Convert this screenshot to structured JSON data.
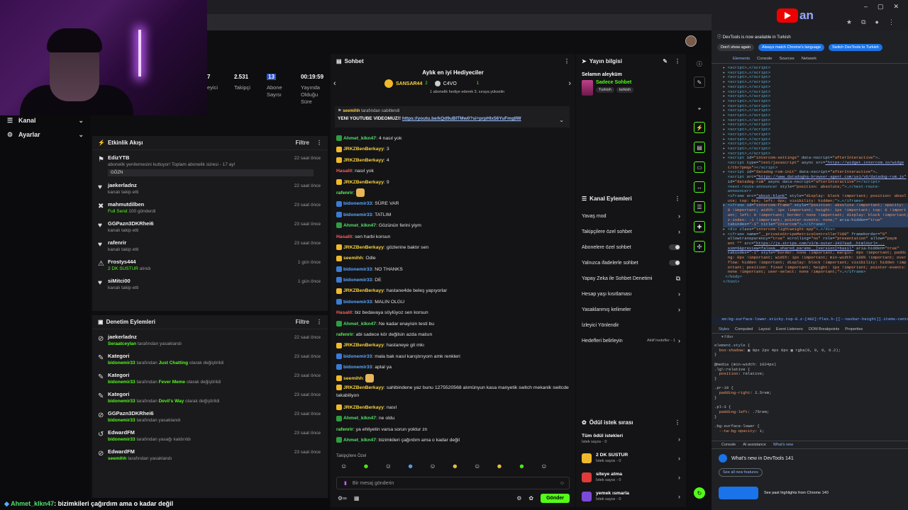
{
  "webcam": {
    "present": true
  },
  "brand": {
    "logo_text": "an"
  },
  "leftnav": {
    "items": [
      {
        "label": "Kanal"
      },
      {
        "label": "Ayarlar"
      }
    ]
  },
  "stats": [
    {
      "value": "7",
      "label": "eyici"
    },
    {
      "value": "2.531",
      "label": "Takipçi"
    },
    {
      "value": "13",
      "label": "Abone Sayısı"
    },
    {
      "value": "00:19:59",
      "label": "Yayında Olduğu Süre"
    }
  ],
  "activity": {
    "title": "Etkinlik Akışı",
    "filter": "Filtre",
    "items": [
      {
        "name": "EdizYTB",
        "sub": "abonelik yenilemesini kutluyor! Toplam abonelik süresi - 17 ay!",
        "tag": "GÖZN",
        "time": "22 saat önce"
      },
      {
        "name": "jaekerladnz",
        "sub": "kanalı takip etti",
        "time": "22 saat önce"
      },
      {
        "name": "mahmutdilben",
        "sub": "Full Send",
        "sub2": "100",
        "sub3": "gönderdi",
        "time": "23 saat önce"
      },
      {
        "name": "GGPazn3DKRhei6",
        "sub": "kanalı takip etti",
        "time": "23 saat önce"
      },
      {
        "name": "rafenrir",
        "sub": "kanalı takip etti",
        "time": "23 saat önce"
      },
      {
        "name": "Frostys444",
        "sub": "2 DK SUSTUR",
        "sub2": "alındı",
        "time": "1 gün önce"
      },
      {
        "name": "siMitci00",
        "sub": "kanalı takip etti",
        "time": "1 gün önce"
      }
    ]
  },
  "moderation": {
    "title": "Denetim Eylemleri",
    "filter": "Filtre",
    "items": [
      {
        "name": "jaekerladnz",
        "actor": "Seraatceylan",
        "action": "tarafından yasaklandı",
        "time": "22 saat önce"
      },
      {
        "name": "Kategori",
        "actor": "bidonemir33",
        "action": "tarafından",
        "cat": "Just Chatting",
        "action2": "olarak değiştirildi",
        "time": "23 saat önce"
      },
      {
        "name": "Kategori",
        "actor": "bidonemir33",
        "action": "tarafından",
        "cat": "Fever Meme",
        "action2": "olarak değiştirildi",
        "time": "23 saat önce"
      },
      {
        "name": "Kategori",
        "actor": "bidonemir33",
        "action": "tarafından",
        "cat": "Devil's Way",
        "action2": "olarak değiştirildi",
        "time": "23 saat önce"
      },
      {
        "name": "GGPazn3DKRhei6",
        "actor": "bidonemir33",
        "action": "tarafından yasaklandı",
        "time": "23 saat önce"
      },
      {
        "name": "EdwardFM",
        "actor": "bidonemir33",
        "action": "tarafından yasağı kaldırıldı",
        "time": "23 saat önce"
      },
      {
        "name": "EdwardFM",
        "actor": "seemihh",
        "action": "tarafından yasaklandı",
        "time": "23 saat önce"
      }
    ]
  },
  "chat": {
    "title": "Sohbet",
    "gift_title": "Aylık en iyi Hediyeciler",
    "gift_top": "SANSAR44",
    "gift_top_count": "2",
    "gift_second": "C4VO",
    "gift_second_count": "1",
    "gift_hint": "1 abonelik hediye ederek 3. sıraya yükselin",
    "pinned_by": "seemihh",
    "pinned_by_suffix": "tarafından sabitlendi",
    "pinned_text": "YENİ YOUTUBE VİDEOMUZ!!",
    "pinned_link": "https://youtu.be/kQd9uBITMw0?si=prpHIx56YuFmgIIW",
    "messages": [
      {
        "user": "Ahmet_klkn47",
        "cls": "u-gr",
        "text": "4 nasıl yok"
      },
      {
        "user": "JRKZBenBerkayy",
        "cls": "u-y",
        "text": "3"
      },
      {
        "user": "JRKZBenBerkayy",
        "cls": "u-y",
        "text": "4"
      },
      {
        "user": "Hasalit",
        "cls": "u-r",
        "text": "nasıl yok"
      },
      {
        "user": "JRKZBenBerkayy",
        "cls": "u-y",
        "text": "9"
      },
      {
        "user": "rafenrir",
        "cls": "u-g",
        "text": ""
      },
      {
        "user": "bidonemir33",
        "cls": "u-b",
        "text": "SÜRE VAR"
      },
      {
        "user": "bidonemir33",
        "cls": "u-b",
        "text": "TATLIM"
      },
      {
        "user": "Ahmet_klkn47",
        "cls": "u-gr",
        "text": "Gözünün ferini yiym"
      },
      {
        "user": "Hasalit",
        "cls": "u-r",
        "text": "sen harbi korsun"
      },
      {
        "user": "JRKZBenBerkayy",
        "cls": "u-y",
        "text": "gözlerine baktır sen"
      },
      {
        "user": "seemihh",
        "cls": "u-y",
        "text": "Odle"
      },
      {
        "user": "bidonemir33",
        "cls": "u-b",
        "text": "NO THANKS"
      },
      {
        "user": "bidonemir33",
        "cls": "u-b",
        "text": "DE"
      },
      {
        "user": "JRKZBenBerkayy",
        "cls": "u-y",
        "text": "hastane4de beleş yapıyorlar"
      },
      {
        "user": "bidonemir33",
        "cls": "u-b",
        "text": "MALIN OLGU"
      },
      {
        "user": "Hasalit",
        "cls": "u-r",
        "text": "biz bedavaya söylüyoz sen korsun"
      },
      {
        "user": "Ahmet_klkn47",
        "cls": "u-gr",
        "text": "Ne kadar enayisin testi bu"
      },
      {
        "user": "rafenrir",
        "cls": "u-g",
        "text": "abi sadece kör değilsin azda malsın"
      },
      {
        "user": "JRKZBenBerkayy",
        "cls": "u-y",
        "text": "hastaneye git mkı"
      },
      {
        "user": "bidonemir33",
        "cls": "u-b",
        "text": "mala bak nasıl karıştırıyorn amk renkleri"
      },
      {
        "user": "bidonemir33",
        "cls": "u-b",
        "text": "aptal ya"
      },
      {
        "user": "seemihh",
        "cls": "u-y",
        "text": ""
      },
      {
        "user": "JRKZBenBerkayy",
        "cls": "u-y",
        "text": "sahibindene yaz bunu 1275520568 alımünyun kasa manyetik switch mekanik switcde takabiliyon"
      },
      {
        "user": "JRKZBenBerkayy",
        "cls": "u-y",
        "text": "nasıl"
      },
      {
        "user": "Ahmet_klkn47",
        "cls": "u-gr",
        "text": "ne oldu"
      },
      {
        "user": "rafenrir",
        "cls": "u-g",
        "text": "ya ehliyetin varsa sorun yoktur zn"
      },
      {
        "user": "Ahmet_klkn47",
        "cls": "u-gr",
        "text": "bizimkileri çağırdım ama o kadar değil"
      }
    ],
    "followers_label": "Takipçilere Özel",
    "input_placeholder": "Bir mesaj gönderin",
    "send": "Gönder"
  },
  "stream_info": {
    "title": "Yayın bilgisi",
    "stream_title": "Selamın aleyküm",
    "category": "Sadece Sohbet",
    "tags": [
      "Turkish",
      "turkish"
    ]
  },
  "channel_actions": {
    "title": "Kanal Eylemleri",
    "items": [
      {
        "label": "Yavaş mod",
        "kind": "arrow"
      },
      {
        "label": "Takipçilere özel sohbet",
        "kind": "arrow"
      },
      {
        "label": "Abonelere özel sohbet",
        "kind": "toggle"
      },
      {
        "label": "Yalnızca ifadelerle sohbet",
        "kind": "toggle"
      },
      {
        "label": "Yapay Zeka ile Sohbet Denetimi",
        "kind": "ext"
      },
      {
        "label": "Hesap yaşı kısıtlaması",
        "kind": "arrow"
      },
      {
        "label": "Yasaklanmış kelimeler",
        "kind": "arrow"
      },
      {
        "label": "İzleyici Yönlendir",
        "kind": "none"
      },
      {
        "label": "Hedefleri belirleyin",
        "kind": "goal",
        "extra": "Aktif hedefler - 1"
      }
    ]
  },
  "rewards": {
    "title": "Ödül istek sırası",
    "items": [
      {
        "label": "Tüm ödül istekleri",
        "sub": "İstek sayısı - 0"
      },
      {
        "label": "2 DK SUSTUR",
        "sub": "İstek sayısı - 0"
      },
      {
        "label": "siteye atma",
        "sub": "İstek sayısı - 0"
      },
      {
        "label": "yemek ısmarla",
        "sub": "İstek sayısı - 0"
      }
    ]
  },
  "devtools": {
    "banner": "DevTools is now available in Turkish",
    "btn1": "Don't show again",
    "btn2": "Always match Chrome's language",
    "btn3": "Switch DevTools to Turkish",
    "tabs": [
      "Elements",
      "Console",
      "Sources",
      "Network"
    ],
    "style_tabs": [
      "Styles",
      "Computed",
      "Layout",
      "Event Listeners",
      "DOM Breakpoints",
      "Properties"
    ],
    "filter": "Filter",
    "drawer_tabs": [
      "Console",
      "AI assistance",
      "What's new"
    ],
    "whats_new": "What's new in DevTools 141",
    "see_all": "See all new features",
    "highlights": "See past highlights from Chrome 140",
    "breadcrumb": "sm:bg-surface-lower.sticky.top-0.z-[402]:flex.h-[[--navbar-height]].items-center.justify-betwe"
  },
  "bottom": {
    "user": "Ahmet_klkn47",
    "text": ": bizimkileri çağırdım ama o kadar değil"
  },
  "colors": {
    "accent": "#53fc18",
    "bg": "#0e0e10",
    "panel": "#1a1a1d"
  }
}
